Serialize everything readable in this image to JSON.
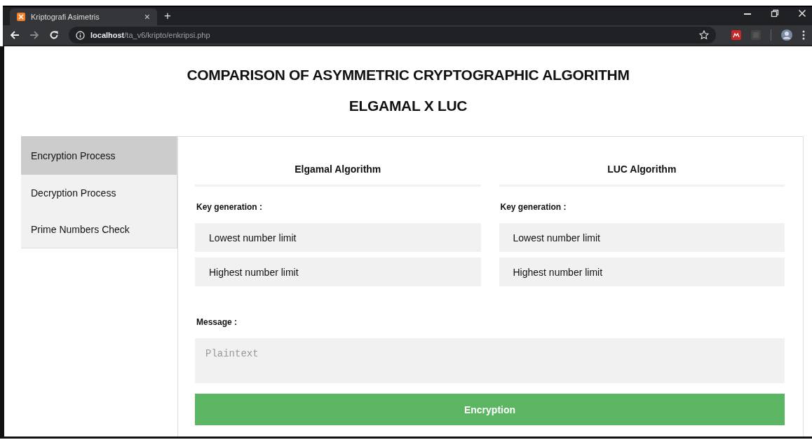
{
  "browser": {
    "tab": {
      "title": "Kriptografi Asimetris",
      "close": "×",
      "selected": true
    },
    "new_tab": "+",
    "address": {
      "host": "localhost",
      "path": "/ta_v6/kripto/enkripsi.php"
    }
  },
  "page": {
    "title_lines": [
      "COMPARISON OF ASYMMETRIC CRYPTOGRAPHIC ALGORITHM",
      "ELGAMAL X LUC"
    ],
    "sidebar": {
      "items": [
        {
          "label": "Encryption Process",
          "selected": true
        },
        {
          "label": "Decryption Process",
          "selected": false
        },
        {
          "label": "Prime Numbers Check",
          "selected": false
        }
      ]
    },
    "algorithms": [
      {
        "heading": "Elgamal Algorithm",
        "section_label": "Key generation :",
        "fields": [
          {
            "placeholder": "Lowest number limit"
          },
          {
            "placeholder": "Highest number limit"
          }
        ]
      },
      {
        "heading": "LUC Algorithm",
        "section_label": "Key generation :",
        "fields": [
          {
            "placeholder": "Lowest number limit"
          },
          {
            "placeholder": "Highest number limit"
          }
        ]
      }
    ],
    "message": {
      "label": "Message :",
      "placeholder": "Plaintext"
    },
    "submit_button": "Encryption"
  }
}
